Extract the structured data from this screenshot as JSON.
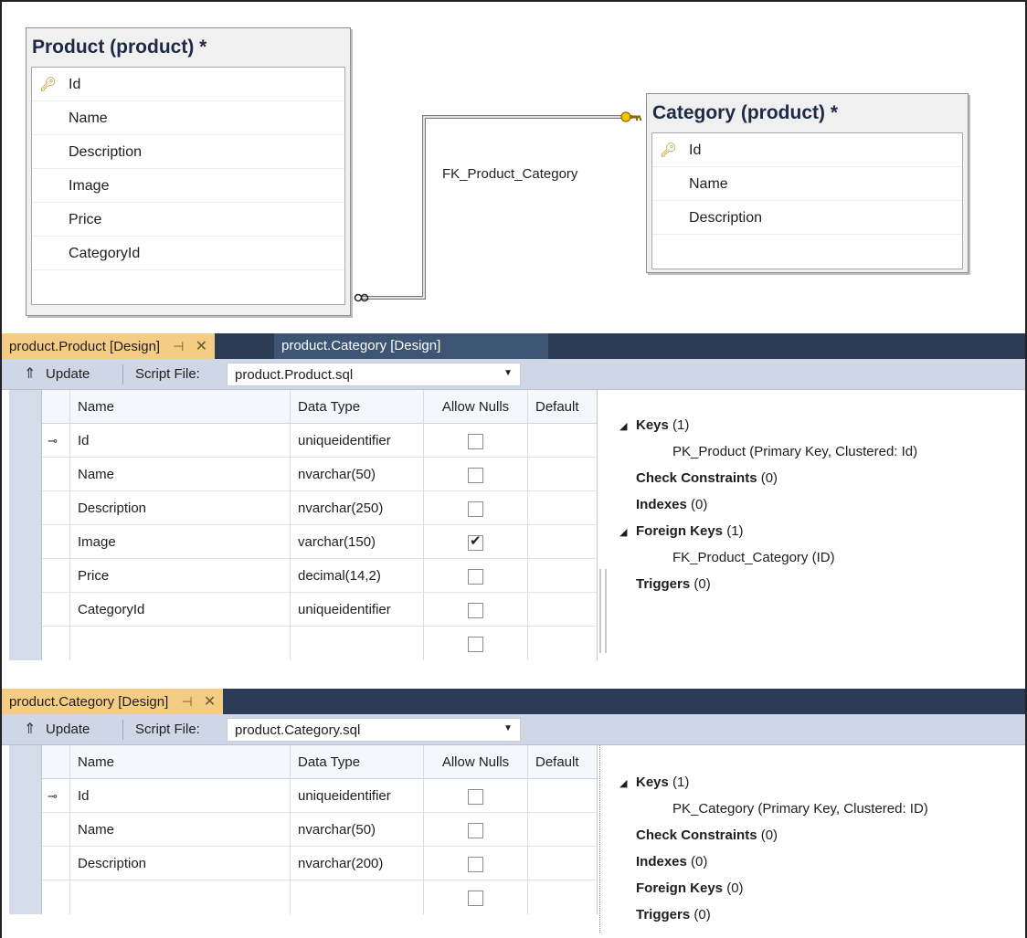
{
  "diagram": {
    "product": {
      "title": "Product (product) *",
      "columns": [
        "Id",
        "Name",
        "Description",
        "Image",
        "Price",
        "CategoryId"
      ]
    },
    "category": {
      "title": "Category (product) *",
      "columns": [
        "Id",
        "Name",
        "Description"
      ]
    },
    "relationship": "FK_Product_Category"
  },
  "product_designer": {
    "tabs": [
      "product.Product [Design]",
      "product.Category [Design]"
    ],
    "pin": "⊣",
    "close": "✕",
    "toolbar": {
      "update": "Update",
      "script_label": "Script File:",
      "script_value": "product.Product.sql"
    },
    "headers": {
      "name": "Name",
      "type": "Data Type",
      "nulls": "Allow Nulls",
      "default": "Default"
    },
    "rows": [
      {
        "name": "Id",
        "type": "uniqueidentifier",
        "nulls": false,
        "key": true
      },
      {
        "name": "Name",
        "type": "nvarchar(50)",
        "nulls": false
      },
      {
        "name": "Description",
        "type": "nvarchar(250)",
        "nulls": false
      },
      {
        "name": "Image",
        "type": "varchar(150)",
        "nulls": true
      },
      {
        "name": "Price",
        "type": "decimal(14,2)",
        "nulls": false
      },
      {
        "name": "CategoryId",
        "type": "uniqueidentifier",
        "nulls": false
      }
    ],
    "props": {
      "keys": "Keys",
      "keys_count": "(1)",
      "pk": "PK_Product   (Primary Key, Clustered: Id)",
      "checks": "Check Constraints",
      "checks_count": "(0)",
      "indexes": "Indexes",
      "indexes_count": "(0)",
      "fks": "Foreign Keys",
      "fks_count": "(1)",
      "fk": "FK_Product_Category   (ID)",
      "triggers": "Triggers",
      "triggers_count": "(0)"
    }
  },
  "category_designer": {
    "tabs": [
      "product.Category [Design]"
    ],
    "toolbar": {
      "update": "Update",
      "script_label": "Script File:",
      "script_value": "product.Category.sql"
    },
    "headers": {
      "name": "Name",
      "type": "Data Type",
      "nulls": "Allow Nulls",
      "default": "Default"
    },
    "rows": [
      {
        "name": "Id",
        "type": "uniqueidentifier",
        "nulls": false,
        "key": true
      },
      {
        "name": "Name",
        "type": "nvarchar(50)",
        "nulls": false
      },
      {
        "name": "Description",
        "type": "nvarchar(200)",
        "nulls": false
      }
    ],
    "props": {
      "keys": "Keys",
      "keys_count": "(1)",
      "pk": "PK_Category   (Primary Key, Clustered: ID)",
      "checks": "Check Constraints",
      "checks_count": "(0)",
      "indexes": "Indexes",
      "indexes_count": "(0)",
      "fks": "Foreign Keys",
      "fks_count": "(0)",
      "triggers": "Triggers",
      "triggers_count": "(0)"
    }
  },
  "icons": {
    "key": "key-icon",
    "pk": "primary-key-icon",
    "update": "update-arrow-icon",
    "dropdown": "chevron-down-icon"
  }
}
